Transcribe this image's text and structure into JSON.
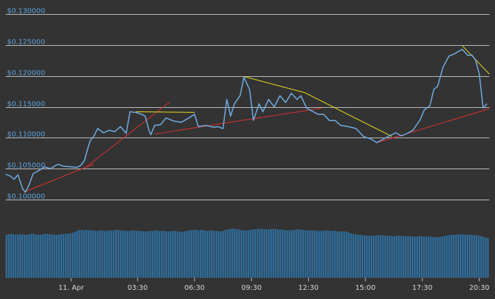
{
  "chart_data": {
    "type": "line",
    "grid": true,
    "colors": {
      "background": "#333333",
      "grid": "#bfbfbf",
      "price_line": "#6fa8dc",
      "axis_label": "#5ba3e0",
      "x_label": "#d9d9d9",
      "support_line": "#e03030",
      "resistance_line": "#f0e020",
      "volume_bar": "#2f6f9f"
    },
    "y_ticks": [
      {
        "value": 0.13,
        "label": "$0.130000"
      },
      {
        "value": 0.125,
        "label": "$0.125000"
      },
      {
        "value": 0.12,
        "label": "$0.120000"
      },
      {
        "value": 0.115,
        "label": "$0.115000"
      },
      {
        "value": 0.11,
        "label": "$0.110000"
      },
      {
        "value": 0.105,
        "label": "$0.105000"
      },
      {
        "value": 0.1,
        "label": "$0.100000"
      }
    ],
    "ylim": [
      0.0985,
      0.1325
    ],
    "x_ticks": [
      {
        "hour": 4,
        "label": "11. Apr"
      },
      {
        "hour": 7.5,
        "label": "03:30"
      },
      {
        "hour": 10.5,
        "label": "06:30"
      },
      {
        "hour": 13.5,
        "label": "09:30"
      },
      {
        "hour": 16.5,
        "label": "12:30"
      },
      {
        "hour": 19.5,
        "label": "15:00"
      },
      {
        "hour": 22.5,
        "label": "17:30"
      },
      {
        "hour": 25.5,
        "label": "20:30"
      }
    ],
    "xlim": [
      0.55,
      26.03
    ],
    "price_series": {
      "x": [
        0.55,
        0.8,
        1.0,
        1.2,
        1.45,
        1.6,
        1.8,
        2.0,
        2.3,
        2.6,
        2.9,
        3.3,
        3.6,
        4.0,
        4.3,
        4.5,
        4.7,
        4.85,
        5.0,
        5.2,
        5.4,
        5.7,
        6.0,
        6.3,
        6.6,
        6.9,
        7.1,
        7.4,
        7.7,
        7.9,
        8.1,
        8.2,
        8.4,
        8.7,
        9.0,
        9.4,
        9.8,
        10.2,
        10.5,
        10.7,
        11.1,
        11.5,
        11.7,
        12.0,
        12.2,
        12.4,
        12.6,
        12.9,
        13.1,
        13.4,
        13.6,
        13.9,
        14.1,
        14.4,
        14.7,
        15.0,
        15.3,
        15.6,
        15.9,
        16.1,
        16.4,
        16.7,
        17.0,
        17.3,
        17.6,
        17.9,
        18.2,
        18.6,
        19.0,
        19.4,
        19.8,
        20.1,
        20.4,
        20.7,
        21.1,
        21.4,
        21.7,
        22.0,
        22.4,
        22.6,
        22.9,
        23.1,
        23.3,
        23.6,
        23.9,
        24.2,
        24.6,
        24.9,
        25.1,
        25.3,
        25.5,
        25.7,
        25.9
      ],
      "y": [
        0.1041,
        0.1038,
        0.1033,
        0.104,
        0.1017,
        0.1012,
        0.1025,
        0.1042,
        0.1047,
        0.1053,
        0.105,
        0.1057,
        0.1054,
        0.1053,
        0.1052,
        0.1055,
        0.1063,
        0.108,
        0.1095,
        0.1103,
        0.1115,
        0.1108,
        0.1112,
        0.111,
        0.1118,
        0.1107,
        0.1142,
        0.1141,
        0.1138,
        0.1135,
        0.1112,
        0.1105,
        0.112,
        0.1121,
        0.1132,
        0.1127,
        0.1125,
        0.1132,
        0.1138,
        0.1118,
        0.112,
        0.1117,
        0.1118,
        0.1115,
        0.1162,
        0.1135,
        0.1155,
        0.1168,
        0.1198,
        0.1178,
        0.1128,
        0.1155,
        0.1142,
        0.1162,
        0.115,
        0.1168,
        0.1157,
        0.1172,
        0.1162,
        0.1168,
        0.1148,
        0.1143,
        0.1138,
        0.1138,
        0.1128,
        0.1128,
        0.112,
        0.1118,
        0.1115,
        0.1102,
        0.1098,
        0.1092,
        0.1097,
        0.1102,
        0.1108,
        0.1103,
        0.1107,
        0.1112,
        0.113,
        0.1145,
        0.1152,
        0.1178,
        0.1183,
        0.1215,
        0.1232,
        0.1236,
        0.1243,
        0.1233,
        0.1234,
        0.1226,
        0.1203,
        0.1148,
        0.1155
      ]
    },
    "trend_lines": [
      {
        "kind": "support",
        "from": [
          1.5,
          0.1012
        ],
        "to": [
          5.2,
          0.10575
        ]
      },
      {
        "kind": "support",
        "from": [
          4.8,
          0.1053
        ],
        "to": [
          9.2,
          0.1158
        ]
      },
      {
        "kind": "support",
        "from": [
          8.4,
          0.1106
        ],
        "to": [
          17.2,
          0.1148
        ]
      },
      {
        "kind": "support",
        "from": [
          20.1,
          0.1092
        ],
        "to": [
          26.03,
          0.1147
        ]
      },
      {
        "kind": "resistance",
        "from": [
          7.4,
          0.1142
        ],
        "to": [
          10.5,
          0.1141
        ]
      },
      {
        "kind": "resistance",
        "from": [
          13.1,
          0.1199
        ],
        "to": [
          16.3,
          0.1173
        ]
      },
      {
        "kind": "resistance",
        "from": [
          16.3,
          0.1173
        ],
        "to": [
          20.9,
          0.1102
        ]
      },
      {
        "kind": "resistance",
        "from": [
          24.6,
          0.1249
        ],
        "to": [
          26.03,
          0.1203
        ]
      }
    ],
    "volume_series": {
      "x_start": 0.55,
      "x_end": 26.03,
      "values": [
        0.9,
        0.91,
        0.92,
        0.91,
        0.9,
        0.9,
        0.91,
        0.91,
        0.9,
        0.9,
        0.91,
        0.92,
        0.92,
        0.91,
        0.9,
        0.9,
        0.91,
        0.92,
        0.92,
        0.91,
        0.91,
        0.9,
        0.9,
        0.9,
        0.91,
        0.91,
        0.92,
        0.92,
        0.93,
        0.94,
        0.96,
        0.98,
        1.0,
        1.0,
        0.99,
        1.0,
        1.0,
        0.99,
        0.99,
        0.98,
        0.98,
        0.99,
        0.99,
        0.98,
        0.98,
        0.99,
        0.99,
        0.99,
        1.0,
        1.0,
        0.99,
        0.99,
        0.98,
        0.98,
        0.98,
        0.99,
        0.99,
        0.98,
        0.98,
        0.98,
        0.97,
        0.97,
        0.97,
        0.98,
        0.98,
        0.99,
        0.99,
        0.98,
        0.98,
        0.98,
        0.97,
        0.97,
        0.97,
        0.98,
        0.98,
        0.97,
        0.96,
        0.96,
        0.97,
        0.98,
        0.99,
        1.0,
        1.0,
        1.0,
        0.99,
        1.0,
        1.0,
        0.99,
        0.98,
        0.99,
        0.99,
        0.98,
        0.98,
        0.97,
        0.97,
        0.98,
        1.0,
        1.01,
        1.02,
        1.03,
        1.02,
        1.02,
        1.01,
        1.0,
        0.99,
        0.99,
        0.99,
        1.0,
        1.01,
        1.01,
        1.02,
        1.02,
        1.02,
        1.01,
        1.01,
        1.01,
        1.02,
        1.02,
        1.02,
        1.01,
        1.01,
        1.0,
        1.0,
        0.99,
        0.99,
        1.0,
        1.0,
        1.01,
        1.01,
        1.01,
        1.0,
        1.0,
        0.99,
        0.99,
        0.99,
        0.99,
        0.98,
        0.98,
        0.98,
        0.98,
        0.99,
        0.99,
        0.98,
        0.98,
        0.98,
        0.97,
        0.97,
        0.97,
        0.97,
        0.96,
        0.95,
        0.93,
        0.92,
        0.91,
        0.9,
        0.9,
        0.89,
        0.89,
        0.88,
        0.88,
        0.88,
        0.88,
        0.88,
        0.89,
        0.89,
        0.89,
        0.88,
        0.88,
        0.88,
        0.87,
        0.87,
        0.88,
        0.88,
        0.88,
        0.87,
        0.87,
        0.87,
        0.87,
        0.86,
        0.86,
        0.86,
        0.87,
        0.87,
        0.86,
        0.86,
        0.86,
        0.86,
        0.85,
        0.85,
        0.85,
        0.86,
        0.86,
        0.87,
        0.88,
        0.89,
        0.9,
        0.9,
        0.9,
        0.91,
        0.91,
        0.91,
        0.9,
        0.9,
        0.9,
        0.9,
        0.89,
        0.89,
        0.88,
        0.87,
        0.85,
        0.84,
        0.83
      ]
    }
  }
}
